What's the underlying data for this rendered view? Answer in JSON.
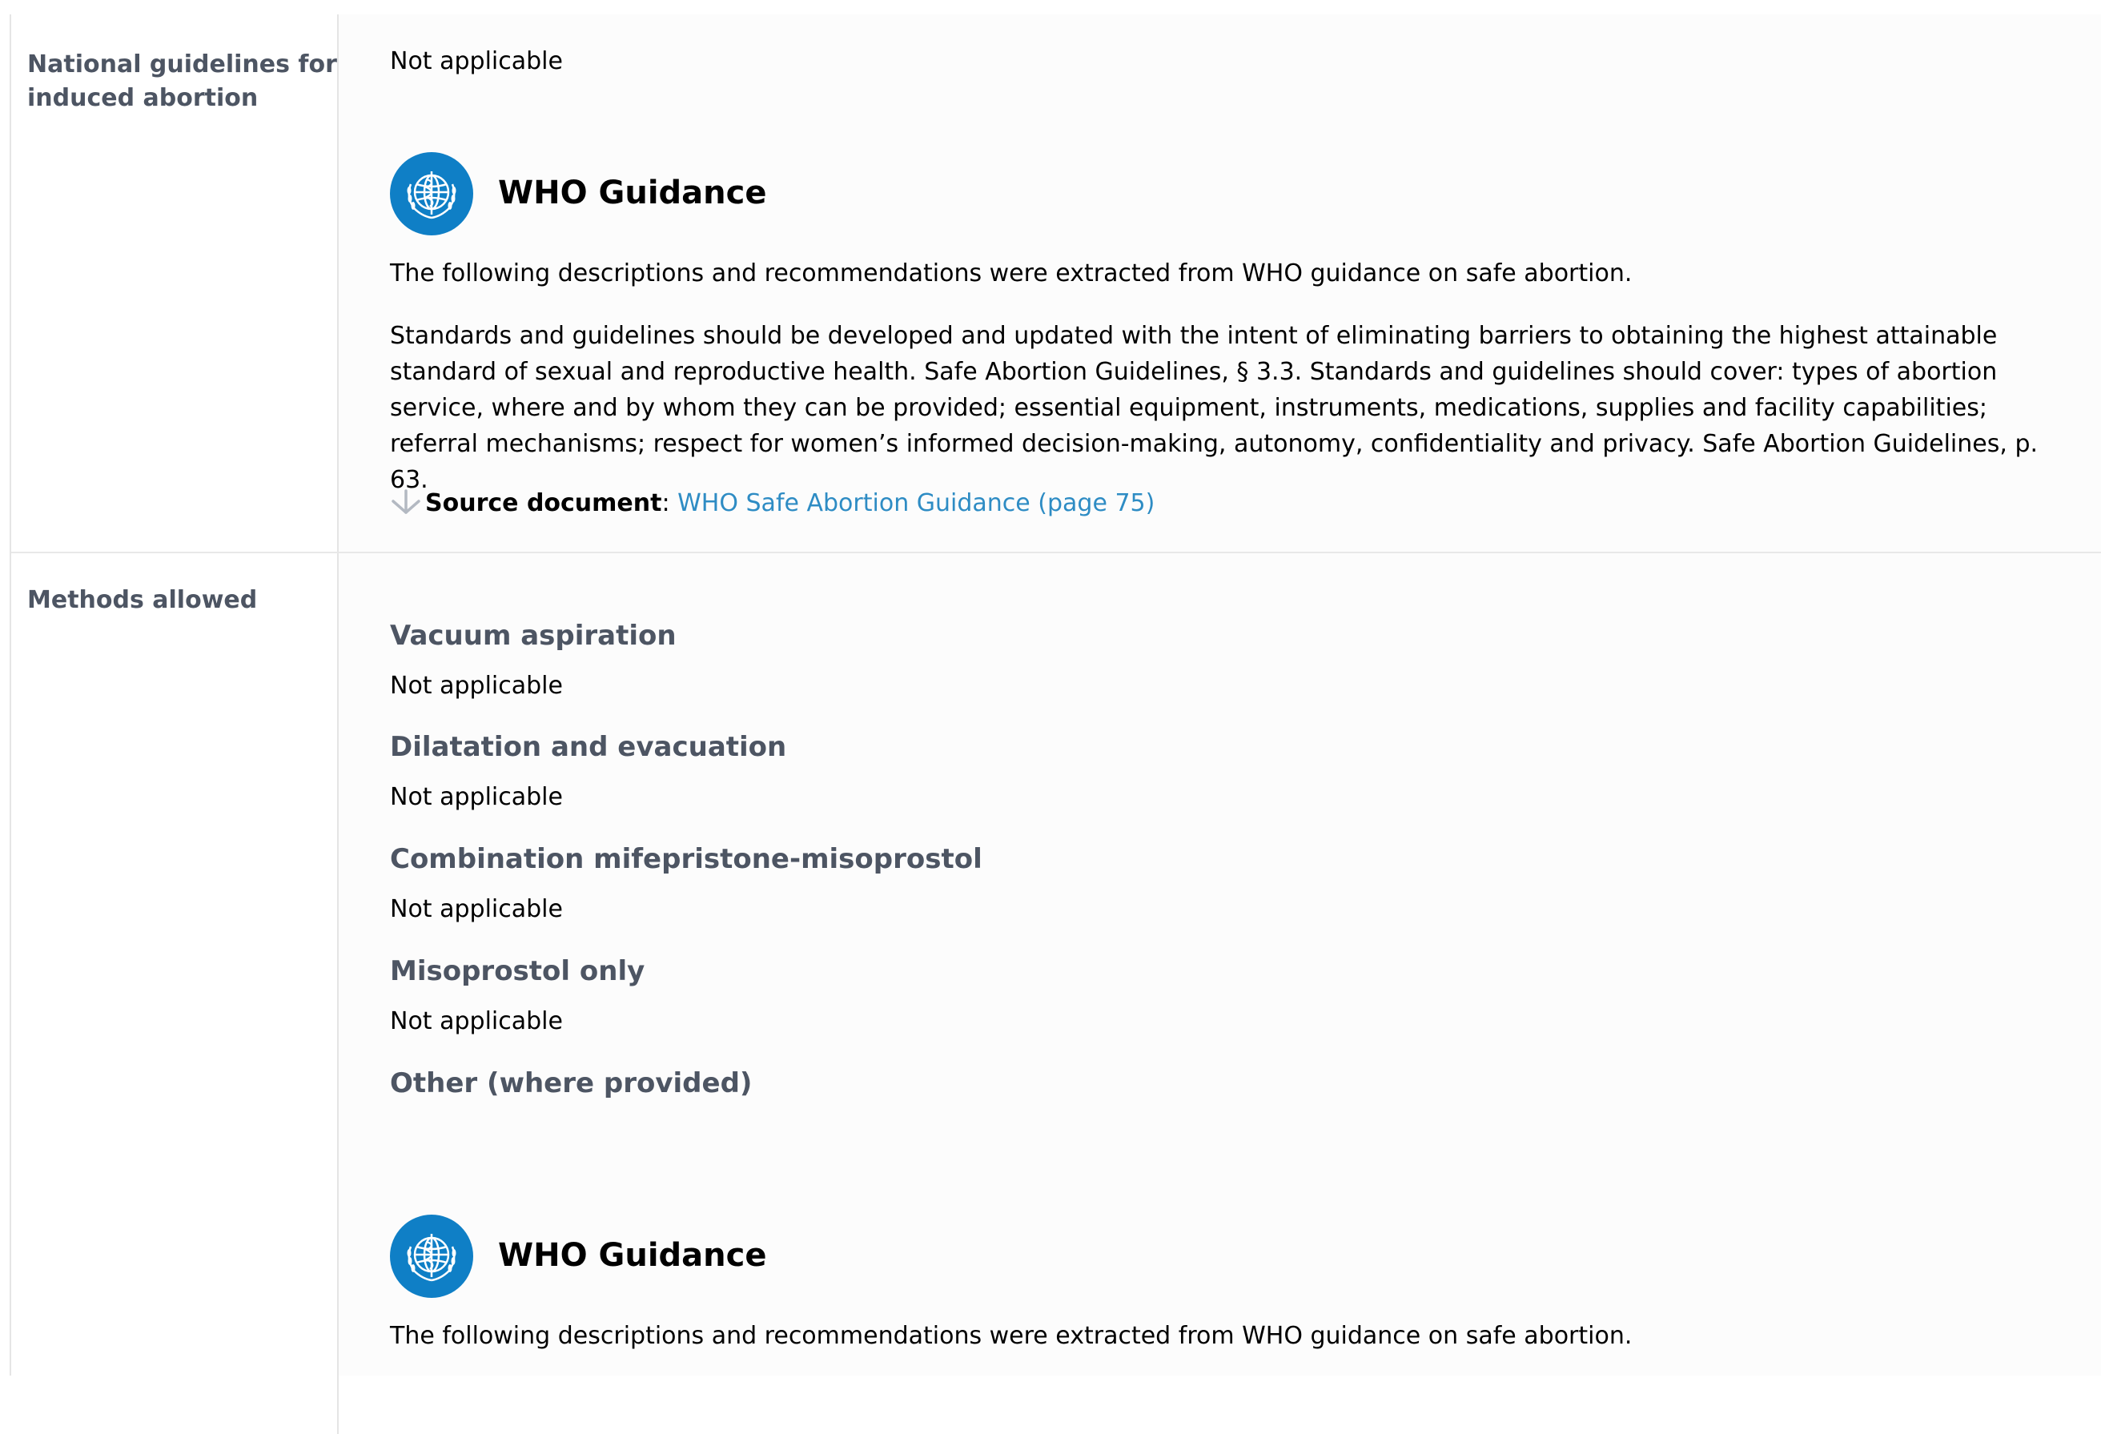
{
  "rows": [
    {
      "label": "National guidelines for induced abortion",
      "status": "Not applicable",
      "who": {
        "title": "WHO Guidance",
        "intro": "The following descriptions and recommendations were extracted from WHO guidance on safe abortion.",
        "text": "Standards and guidelines should be developed and updated with the intent of eliminating barriers to obtaining the highest attainable standard of sexual and reproductive health. Safe Abortion Guidelines, § 3.3. Standards and guidelines should cover: types of abortion service, where and by whom they can be provided; essential equipment, instruments, medications, supplies and facility capabilities; referral mechanisms; respect for women’s informed decision-making, autonomy, confidentiality and privacy. Safe Abortion Guidelines, p. 63.",
        "source_label": "Source document",
        "source_sep": ":",
        "source_link": "WHO Safe Abortion Guidance (page 75)"
      }
    },
    {
      "label": "Methods allowed",
      "methods": [
        {
          "name": "Vacuum aspiration",
          "value": "Not applicable"
        },
        {
          "name": "Dilatation and evacuation",
          "value": "Not applicable"
        },
        {
          "name": "Combination mifepristone-misoprostol",
          "value": "Not applicable"
        },
        {
          "name": "Misoprostol only",
          "value": "Not applicable"
        },
        {
          "name": "Other (where provided)",
          "value": ""
        }
      ],
      "who": {
        "title": "WHO Guidance",
        "intro": "The following descriptions and recommendations were extracted from WHO guidance on safe abortion."
      }
    }
  ],
  "colors": {
    "who_blue": "#0f7fc6",
    "link_blue": "#2e8cc4",
    "label_gray": "#4d5563"
  },
  "icons": {
    "who_logo": "who-emblem-icon",
    "source": "down-arrow-icon"
  }
}
